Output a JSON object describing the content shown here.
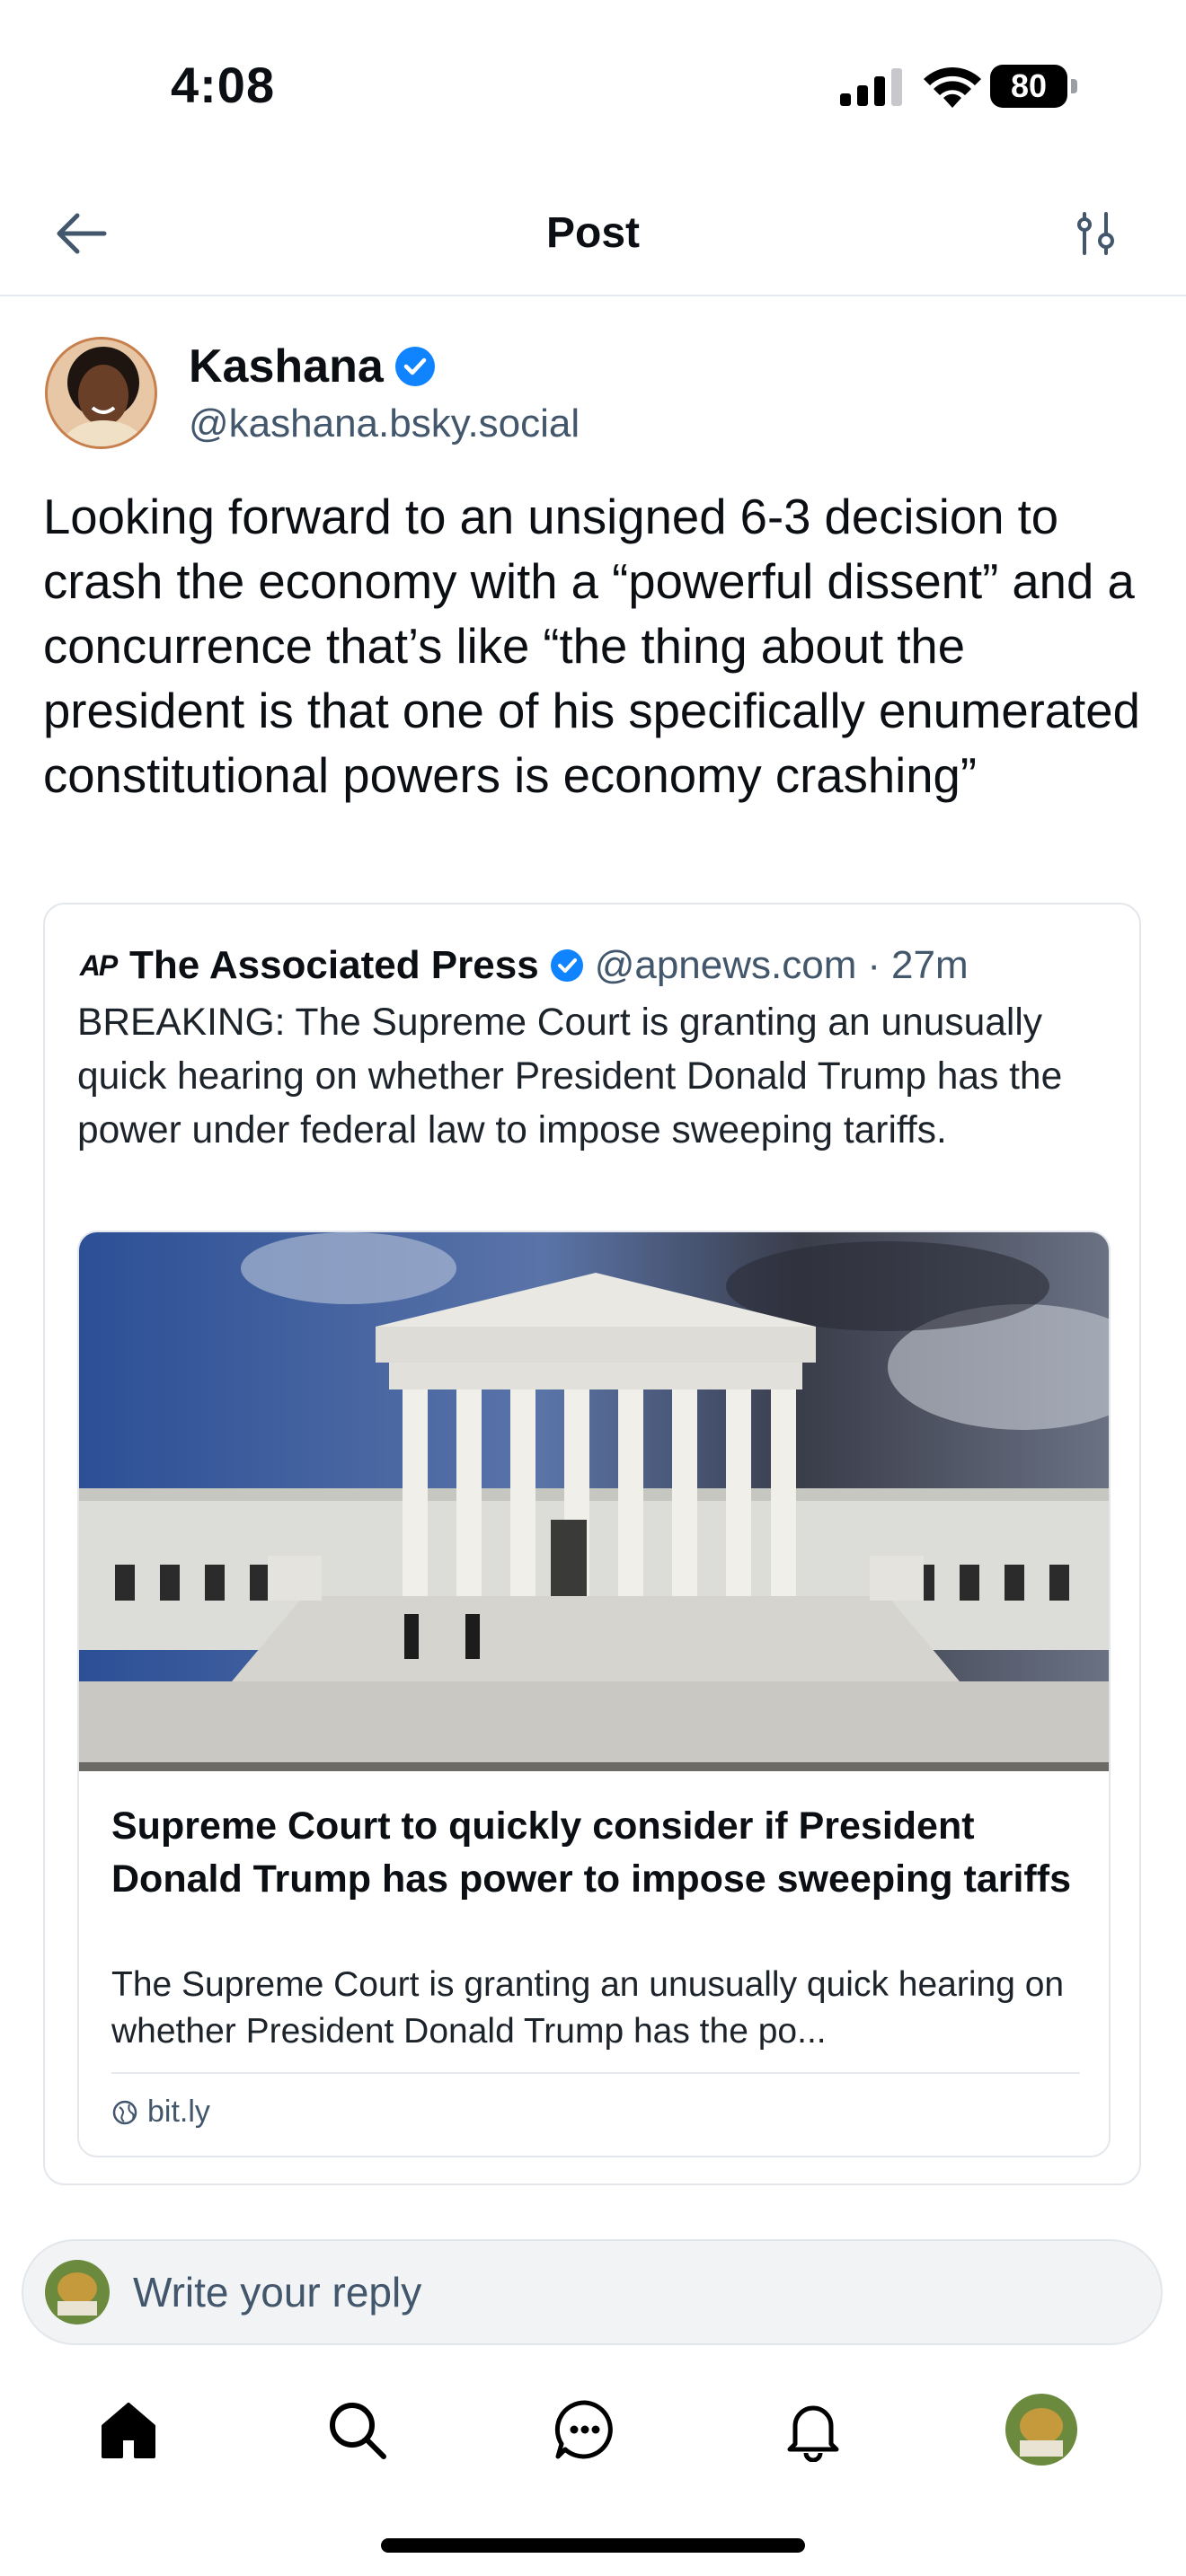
{
  "status_bar": {
    "time": "4:08",
    "battery": "80"
  },
  "header": {
    "title": "Post"
  },
  "post": {
    "author_name": "Kashana",
    "author_handle": "@kashana.bsky.social",
    "text": "Looking forward to an unsigned 6-3 decision to crash the economy with a “powerful dissent” and a concurrence that’s like “the thing about the president is that one of his specifically enumerated constitutional powers is economy crashing”"
  },
  "quote": {
    "logo": "AP",
    "author_name": "The Associated Press",
    "author_handle": "@apnews.com",
    "separator": "·",
    "time": "27m",
    "text": "BREAKING: The Supreme Court is granting an unusually quick hearing on whether President Donald Trump has the power under federal law to impose sweeping tariffs.",
    "link_card": {
      "title": "Supreme Court to quickly consider if President Donald Trump has power to impose sweeping tariffs",
      "description": "The Supreme Court is granting an unusually quick hearing on whether President Donald Trump has the po...",
      "domain": "bit.ly"
    }
  },
  "reply": {
    "placeholder": "Write your reply"
  },
  "nav": {
    "items": [
      "home-icon",
      "search-icon",
      "chat-icon",
      "bell-icon",
      "profile-avatar"
    ]
  },
  "colors": {
    "accent": "#1083fe",
    "text": "#0b0f14",
    "muted": "#42566c",
    "border": "#e3e7ec"
  }
}
